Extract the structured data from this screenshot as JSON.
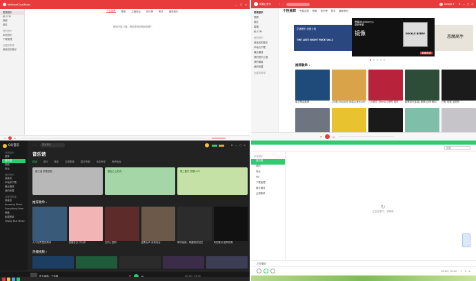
{
  "p1": {
    "app_title": "NetEaseCloudMusic",
    "sidebar": {
      "items": [
        "发现音乐",
        "私人FM",
        "视频",
        "朋友"
      ],
      "group1": "我的音乐",
      "group1_items": [
        "本地音乐",
        "下载管理"
      ],
      "group2": "创建的歌单",
      "group2_items": [
        "我喜欢的音乐"
      ]
    },
    "tabs": [
      "个性推荐",
      "歌单",
      "主播电台",
      "排行榜",
      "歌手",
      "最新音乐"
    ],
    "message": "网络不给力哦，请检查你的网络设置~"
  },
  "p2": {
    "app_title": "网易云音乐",
    "account": "Google ▾",
    "sidebar": {
      "items": [
        "发现音乐",
        "视频",
        "朋友",
        "直播",
        "私人FM"
      ],
      "group": "我的音乐",
      "my_items": [
        "我喜欢的音乐",
        "本地与下载",
        "最近播放",
        "我的音乐云盘",
        "我的播客",
        "我的收藏"
      ],
      "group2": "创建的歌单"
    },
    "tabs": [
      "个性推荐",
      "专属定制",
      "歌单",
      "排行榜",
      "歌手",
      "最新音乐"
    ],
    "banner": {
      "left_title": "THE LATE NIGHT PACK Vol.2",
      "left_sub": "正版音乐 全新上线",
      "center_title": "黑莓(Blackberry)",
      "center_sub": "全新专辑",
      "center_big": "镜像",
      "center_caption": "DECKLE BERRY",
      "right_text": "恶魔高手",
      "tag": "新碟首发"
    },
    "section": "推荐歌单 ›",
    "cards": [
      {
        "cap": "每日歌曲推荐",
        "color": "#1e4b7a"
      },
      {
        "cap": "[华语] 听见欢乐·网易云音乐VAP",
        "color": "#d9a34a"
      },
      {
        "cap": "八大音乐 [Remix] 燃炸 纯享",
        "color": "#b8223a"
      },
      {
        "cap": "欧美流行金曲 [欧美]心情·律动",
        "color": "#2e4d38"
      },
      {
        "cap": "日系·动漫 治愈系",
        "color": "#1b1b1b"
      },
      {
        "cap": "Kpop 舞台 | 经典回顾",
        "color": "#6e7580"
      },
      {
        "cap": "超萌小黄人 OST",
        "color": "#e9c22f"
      },
      {
        "cap": "Hip-Hop 街头节奏",
        "color": "#1a1a1a"
      },
      {
        "cap": "清新 治愈 轻音乐",
        "color": "#7fbfa9"
      },
      {
        "cap": "雨天 Lo-Fi",
        "color": "#c7c4c9"
      }
    ],
    "icon_labels": {
      "magnifier": "search-icon"
    }
  },
  "p3": {
    "logo": "QQ音乐",
    "sidebar": {
      "group1": "在线音乐",
      "items": [
        "推荐",
        "音乐馆",
        "视频",
        "电台"
      ],
      "group2": "我的音乐",
      "my_items": [
        "我喜欢",
        "本地和下载",
        "最近播放",
        "我的收藏"
      ],
      "group3": "创建的歌单",
      "list_items": [
        "我喜欢",
        "Amazing Music",
        "Everything Now",
        "夜跑",
        "私藏歌单",
        "Happy Bus Music"
      ]
    },
    "search": "搜索音乐",
    "title": "音乐馆",
    "tabs": [
      "精选",
      "排行",
      "歌手",
      "分类歌单",
      "数字专辑",
      "手机专享",
      "有声电台"
    ],
    "banners": [
      {
        "text": "薛之谦 新歌首发",
        "color": "#b8b8b8"
      },
      {
        "text": "落在心上的花",
        "color": "#a5d6a7"
      },
      {
        "text": "第二集打 热歌LIVE",
        "color": "#c5e1a5"
      }
    ],
    "section": "推荐歌单 ›",
    "cards": [
      {
        "cap": "大千世界里的周深",
        "color": "#3a5a7a"
      },
      {
        "cap": "甜蜜告白 只为你",
        "color": "#f2b4b4"
      },
      {
        "cap": "古风 | 国风",
        "color": "#5e2b2b"
      },
      {
        "cap": "温柔女声 深夜电台",
        "color": "#6b5a4a"
      },
      {
        "cap": "聆听经典，唤醒美好回忆",
        "color": "#2c2c2c"
      },
      {
        "cap": "风花雪月 国风热歌",
        "color": "#111111"
      }
    ],
    "section2": "热播视频 ›",
    "videos": [
      "#1d3e63",
      "#1f5a3a",
      "#2b2b2b",
      "#3b2d4a",
      "#3d3d55"
    ],
    "player_song": "听见幸福 - 王若琳",
    "player_time": "00:00 / 03:45"
  },
  "p4": {
    "search_placeholder": "搜索",
    "sidebar": {
      "group": "本地音乐",
      "items": [
        "音乐馆",
        "我的",
        "电台",
        "MV",
        "下载管理",
        "最近播放",
        "云端歌单"
      ]
    },
    "loading": "正在加载中，请稍候",
    "status_left": "正在播放",
    "status_right": "00:00 / 00:00"
  },
  "colors": {
    "netease_red": "#e83c3c",
    "qq_green": "#2ecc71"
  }
}
